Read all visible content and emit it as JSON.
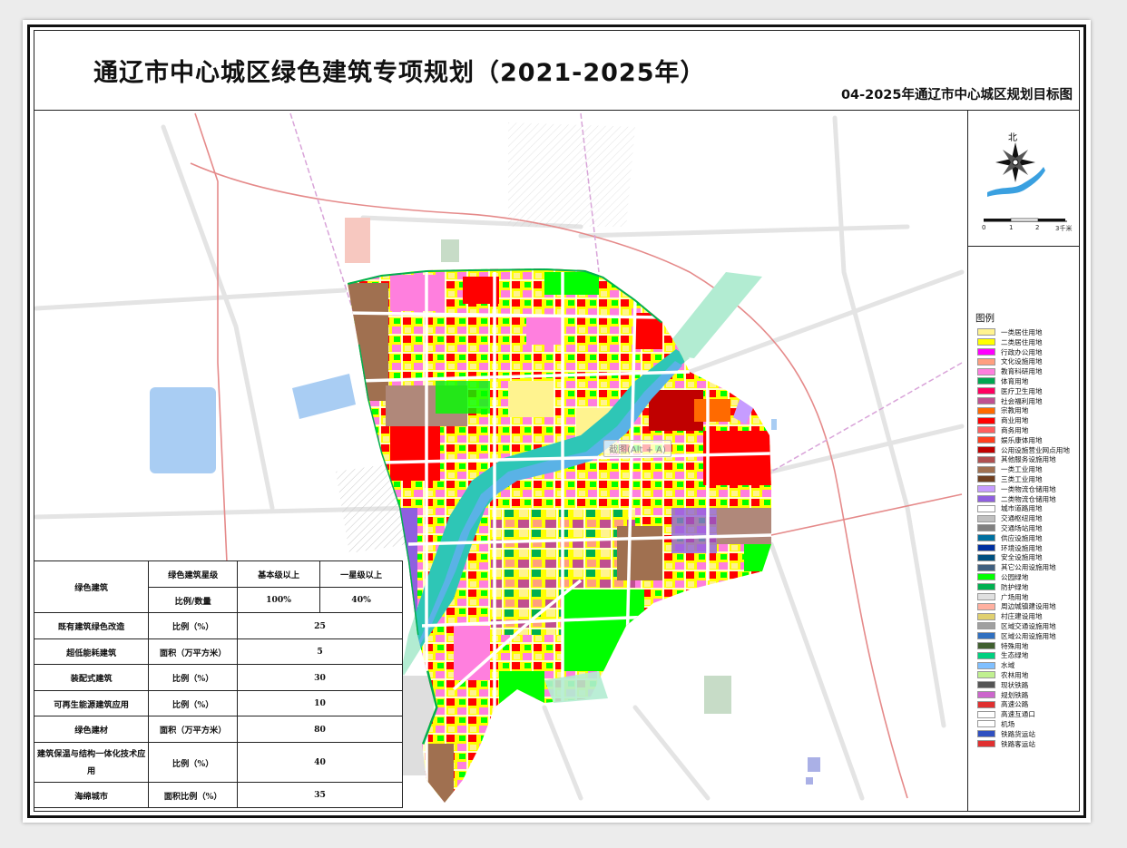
{
  "title": "通辽市中心城区绿色建筑专项规划（2021-2025年）",
  "subtitle": "04-2025年通辽市中心城区规划目标图",
  "compass": {
    "label": "北"
  },
  "scale_bar": {
    "ticks": [
      "0",
      "1",
      "2",
      "3千米"
    ]
  },
  "watermark_text": "截图(Alt + A)",
  "legend": {
    "title": "图例",
    "items": [
      {
        "label": "一类居住用地",
        "color": "#fff38f"
      },
      {
        "label": "二类居住用地",
        "color": "#ffff00"
      },
      {
        "label": "行政办公用地",
        "color": "#ff00ff"
      },
      {
        "label": "文化设施用地",
        "color": "#ff9f7f"
      },
      {
        "label": "教育科研用地",
        "color": "#ff7fde"
      },
      {
        "label": "体育用地",
        "color": "#00a650"
      },
      {
        "label": "医疗卫生用地",
        "color": "#ff0060"
      },
      {
        "label": "社会福利用地",
        "color": "#c05090"
      },
      {
        "label": "宗教用地",
        "color": "#ff6a00"
      },
      {
        "label": "商业用地",
        "color": "#ff0000"
      },
      {
        "label": "商务用地",
        "color": "#ff5f5f"
      },
      {
        "label": "娱乐康体用地",
        "color": "#ff3f1f"
      },
      {
        "label": "公用设施营业网点用地",
        "color": "#c00000"
      },
      {
        "label": "其他服务设施用地",
        "color": "#b05050"
      },
      {
        "label": "一类工业用地",
        "color": "#a07050"
      },
      {
        "label": "三类工业用地",
        "color": "#704020"
      },
      {
        "label": "一类物流仓储用地",
        "color": "#c69cff"
      },
      {
        "label": "二类物流仓储用地",
        "color": "#8f5fdf"
      },
      {
        "label": "城市道路用地",
        "color": "#ffffff"
      },
      {
        "label": "交通枢纽用地",
        "color": "#c0c0c0"
      },
      {
        "label": "交通场站用地",
        "color": "#808080"
      },
      {
        "label": "供应设施用地",
        "color": "#0070a0"
      },
      {
        "label": "环境设施用地",
        "color": "#0030a0"
      },
      {
        "label": "安全设施用地",
        "color": "#005080"
      },
      {
        "label": "其它公用设施用地",
        "color": "#406080"
      },
      {
        "label": "公园绿地",
        "color": "#00ff00"
      },
      {
        "label": "防护绿地",
        "color": "#00b050"
      },
      {
        "label": "广场用地",
        "color": "#e0e0e0"
      },
      {
        "label": "周边城镇建设用地",
        "color": "#ffb0a0"
      },
      {
        "label": "村庄建设用地",
        "color": "#e0d070"
      },
      {
        "label": "区域交通设施用地",
        "color": "#a0a0a0"
      },
      {
        "label": "区域公用设施用地",
        "color": "#3070c0"
      },
      {
        "label": "特殊用地",
        "color": "#406030"
      },
      {
        "label": "生态绿地",
        "color": "#00d080"
      },
      {
        "label": "水域",
        "color": "#80c0ff"
      },
      {
        "label": "农林用地",
        "color": "#c0f090"
      },
      {
        "label": "现状铁路",
        "color": "#555555"
      },
      {
        "label": "规划铁路",
        "color": "#cc66cc"
      },
      {
        "label": "高速公路",
        "color": "#e03030"
      },
      {
        "label": "高速互通口",
        "color": "#ffffff"
      },
      {
        "label": "机场",
        "color": "#ffffff"
      },
      {
        "label": "铁路货运站",
        "color": "#3050c0"
      },
      {
        "label": "铁路客运站",
        "color": "#e03030"
      }
    ]
  },
  "targets_table": {
    "header": {
      "category": "绿色建筑",
      "row1": {
        "measure": "绿色建筑星级",
        "a": "基本级以上",
        "b": "一星级以上"
      },
      "row2": {
        "measure": "比例/数量",
        "a": "100%",
        "b": "40%"
      }
    },
    "rows": [
      {
        "name": "既有建筑绿色改造",
        "measure": "比例（%）",
        "value": "25"
      },
      {
        "name": "超低能耗建筑",
        "measure": "面积（万平方米）",
        "value": "5"
      },
      {
        "name": "装配式建筑",
        "measure": "比例（%）",
        "value": "30"
      },
      {
        "name": "可再生能源建筑应用",
        "measure": "比例（%）",
        "value": "10"
      },
      {
        "name": "绿色建材",
        "measure": "面积（万平方米）",
        "value": "80"
      },
      {
        "name": "建筑保温与结构一体化技术应用",
        "measure": "比例（%）",
        "value": "40"
      },
      {
        "name": "海绵城市",
        "measure": "面积比例（%）",
        "value": "35"
      }
    ]
  }
}
